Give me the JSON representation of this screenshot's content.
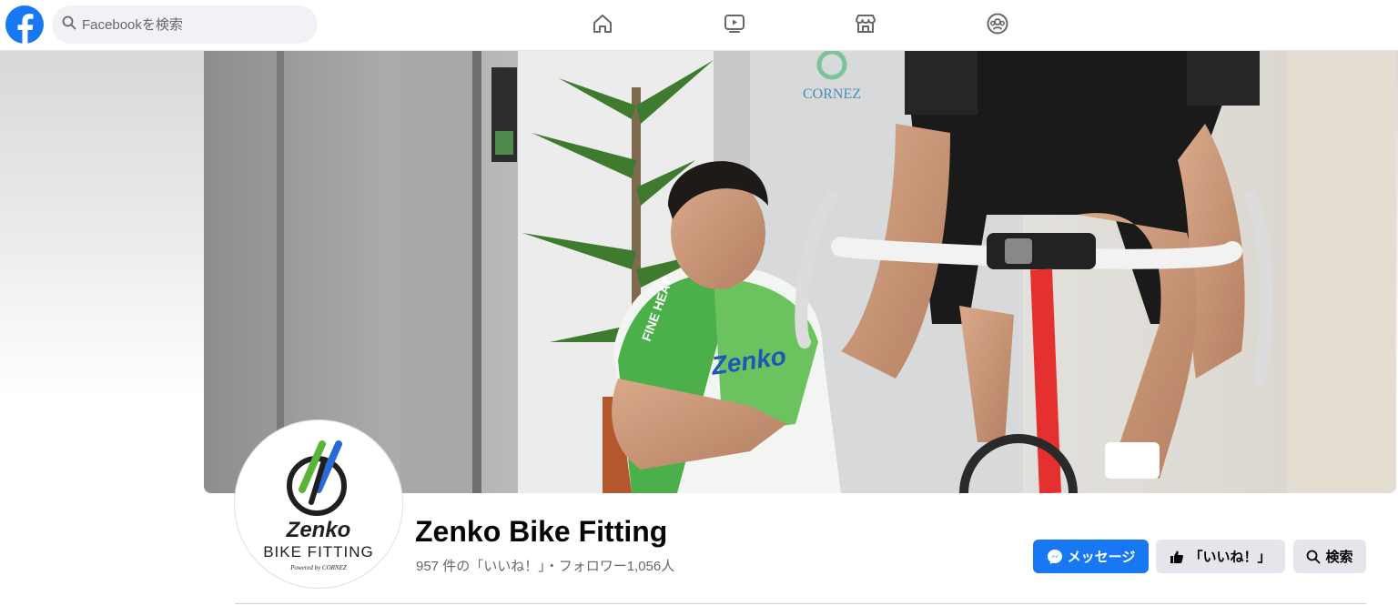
{
  "search": {
    "placeholder": "Facebookを検索"
  },
  "nav": {
    "items": [
      {
        "icon": "home-icon"
      },
      {
        "icon": "video-icon"
      },
      {
        "icon": "marketplace-icon"
      },
      {
        "icon": "groups-icon"
      }
    ]
  },
  "cover": {
    "sign_text": "CORNEZ",
    "jersey_text": "Zenko",
    "jersey_side_text": "FINE HEAT"
  },
  "profile": {
    "name": "Zenko Bike Fitting",
    "stats": "957 件の「いいね！」・フォロワー1,056人",
    "logo_text_1": "Zenko",
    "logo_text_2": "BIKE FITTING",
    "logo_text_3": "Powered by CORNEZ"
  },
  "actions": {
    "message_label": "メッセージ",
    "like_label": "「いいね！」",
    "search_label": "検索"
  },
  "colors": {
    "brand": "#1877f2",
    "button_gray": "#e4e6eb",
    "logo_green": "#5bb33a",
    "logo_blue": "#2a6ad6"
  }
}
